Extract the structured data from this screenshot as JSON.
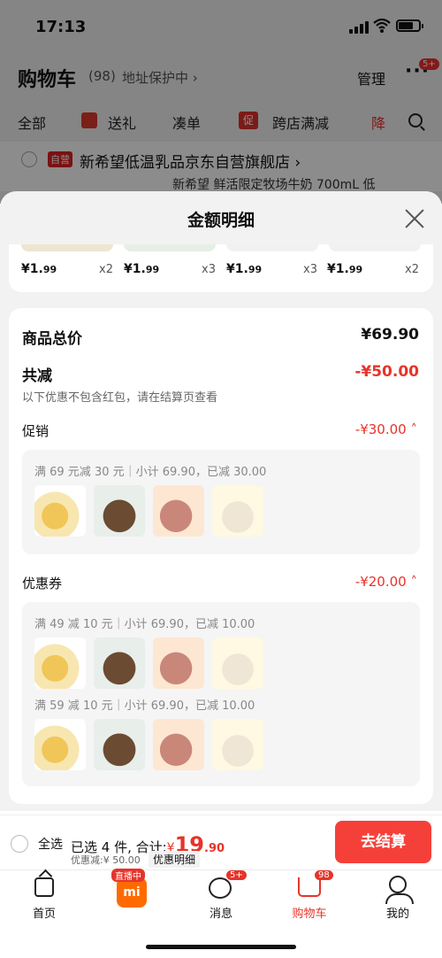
{
  "status": {
    "time": "17:13"
  },
  "background": {
    "title": "购物车",
    "count": "(98)",
    "address": "地址保护中 ›",
    "manage": "管理",
    "more": "···",
    "more_badge": "5+",
    "filters": [
      "全部",
      "送礼",
      "凑单",
      "跨店满减",
      "降"
    ],
    "promo_icon": "促",
    "store": {
      "tag": "自营",
      "name": "新希望低温乳品京东自营旗舰店 ›",
      "subtitle": "新希望 鲜活限定牧场牛奶 700mL 低"
    }
  },
  "sheet": {
    "title": "金额明细",
    "items": [
      {
        "price": "¥1.",
        "dec": "99",
        "qty": "x2"
      },
      {
        "price": "¥1.",
        "dec": "99",
        "qty": "x3"
      },
      {
        "price": "¥1.",
        "dec": "99",
        "qty": "x3"
      },
      {
        "price": "¥1.",
        "dec": "99",
        "qty": "x2"
      }
    ],
    "total_label": "商品总价",
    "total_value": "¥69.90",
    "reduce_label": "共减",
    "reduce_value": "-¥50.00",
    "note": "以下优惠不包含红包，请在结算页查看",
    "promo": {
      "label": "促销",
      "value": "-¥30.00",
      "rule": "满 69 元减 30 元｜小计 69.90，已减 30.00"
    },
    "coupon": {
      "label": "优惠券",
      "value": "-¥20.00",
      "rules": [
        "满 49 减 10 元｜小计 69.90，已减 10.00",
        "满 59 减 10 元｜小计 69.90，已减 10.00"
      ]
    }
  },
  "bottom": {
    "select_all": "全选",
    "selected": "已选 4 件, 合计:",
    "currency": "¥",
    "total_int": "19",
    "total_dec": ".90",
    "discount": "优惠减:¥ 50.00",
    "detail": "优惠明细",
    "checkout": "去结算"
  },
  "tabs": [
    {
      "label": "首页",
      "icon": "home-icon"
    },
    {
      "label": "",
      "icon": "live-icon",
      "tag": "直播中",
      "glyph": "mi"
    },
    {
      "label": "消息",
      "icon": "message-icon",
      "badge": "5+"
    },
    {
      "label": "购物车",
      "icon": "cart-icon",
      "badge": "98"
    },
    {
      "label": "我的",
      "icon": "profile-icon"
    }
  ],
  "colors": {
    "accent": "#e6342a",
    "checkout": "#f5403a"
  }
}
